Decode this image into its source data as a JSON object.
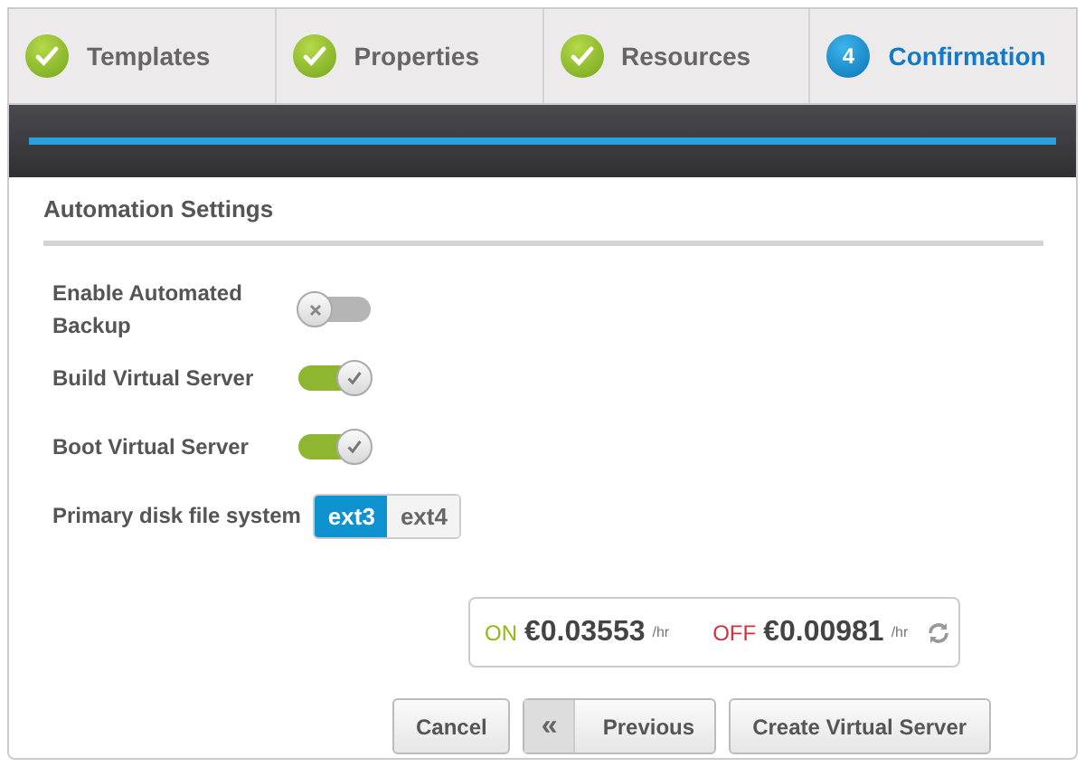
{
  "steps": [
    {
      "label": "Templates",
      "done": true,
      "selected": false
    },
    {
      "label": "Properties",
      "done": true,
      "selected": false
    },
    {
      "label": "Resources",
      "done": true,
      "selected": false
    },
    {
      "label": "Confirmation",
      "done": false,
      "number": "4",
      "selected": true
    }
  ],
  "progress": {
    "level": 1
  },
  "section": {
    "title": "Automation Settings"
  },
  "settings": [
    {
      "kind": "toggle",
      "label": "Enable Automated Backup",
      "on": false
    },
    {
      "kind": "toggle",
      "label": "Build Virtual Server",
      "on": true
    },
    {
      "kind": "toggle",
      "label": "Boot Virtual Server",
      "on": true
    },
    {
      "kind": "segmented",
      "label": "Primary disk file system",
      "options": [
        {
          "label": "ext3",
          "selected": true
        },
        {
          "label": "ext4",
          "selected": false
        }
      ]
    }
  ],
  "pricing": {
    "on_label": "ON",
    "on_price": "€0.03553",
    "on_unit": "/hr",
    "off_label": "OFF",
    "off_price": "€0.00981",
    "off_unit": "/hr"
  },
  "buttons": [
    {
      "kind": "plain",
      "label": "Cancel"
    },
    {
      "kind": "back",
      "icon": "«",
      "label": "Previous"
    },
    {
      "kind": "plain",
      "label": "Create Virtual Server"
    }
  ]
}
